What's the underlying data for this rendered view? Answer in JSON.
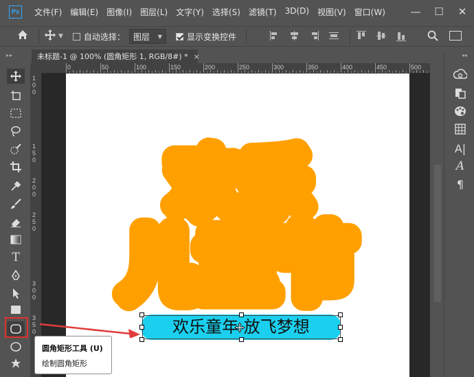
{
  "menubar": {
    "logo": "Ps",
    "items": [
      "文件(F)",
      "编辑(E)",
      "图像(I)",
      "图层(L)",
      "文字(Y)",
      "选择(S)",
      "滤镜(T)",
      "3D(D)",
      "视图(V)",
      "窗口(W)"
    ],
    "window_controls": [
      "—",
      "☐",
      "✕"
    ]
  },
  "options": {
    "home_icon": "home-icon",
    "move_icon": "move-icon",
    "auto_select_label": "自动选择：",
    "auto_select_checked": false,
    "layer_select_value": "图层",
    "show_transform_label": "显示变换控件",
    "show_transform_checked": true
  },
  "document": {
    "tab_title": "未标题-1 @ 100% (圆角矩形 1, RGB/8#) *",
    "close": "×"
  },
  "ruler_top": [
    "0",
    "50",
    "100",
    "150",
    "200",
    "250",
    "300",
    "350",
    "400",
    "450",
    "500"
  ],
  "ruler_left": [
    "1\n0\n0",
    "1\n5\n0",
    "2\n0\n0",
    "2\n5\n0",
    "3\n0\n0",
    "3\n5\n0"
  ],
  "artwork": {
    "title_line1": "欢乐",
    "title_line2": "儿童节",
    "caption": "欢乐童年 放飞梦想",
    "title_fill": "#ffffff",
    "title_outline": "#ffa000",
    "caption_bg": "#1bd0ef"
  },
  "tooltip": {
    "title": "圆角矩形工具 (U)",
    "description": "绘制圆角矩形"
  },
  "colors": {
    "ui_bg": "#535353",
    "highlight": "#e0302c",
    "arrow": "#e03c3c"
  }
}
